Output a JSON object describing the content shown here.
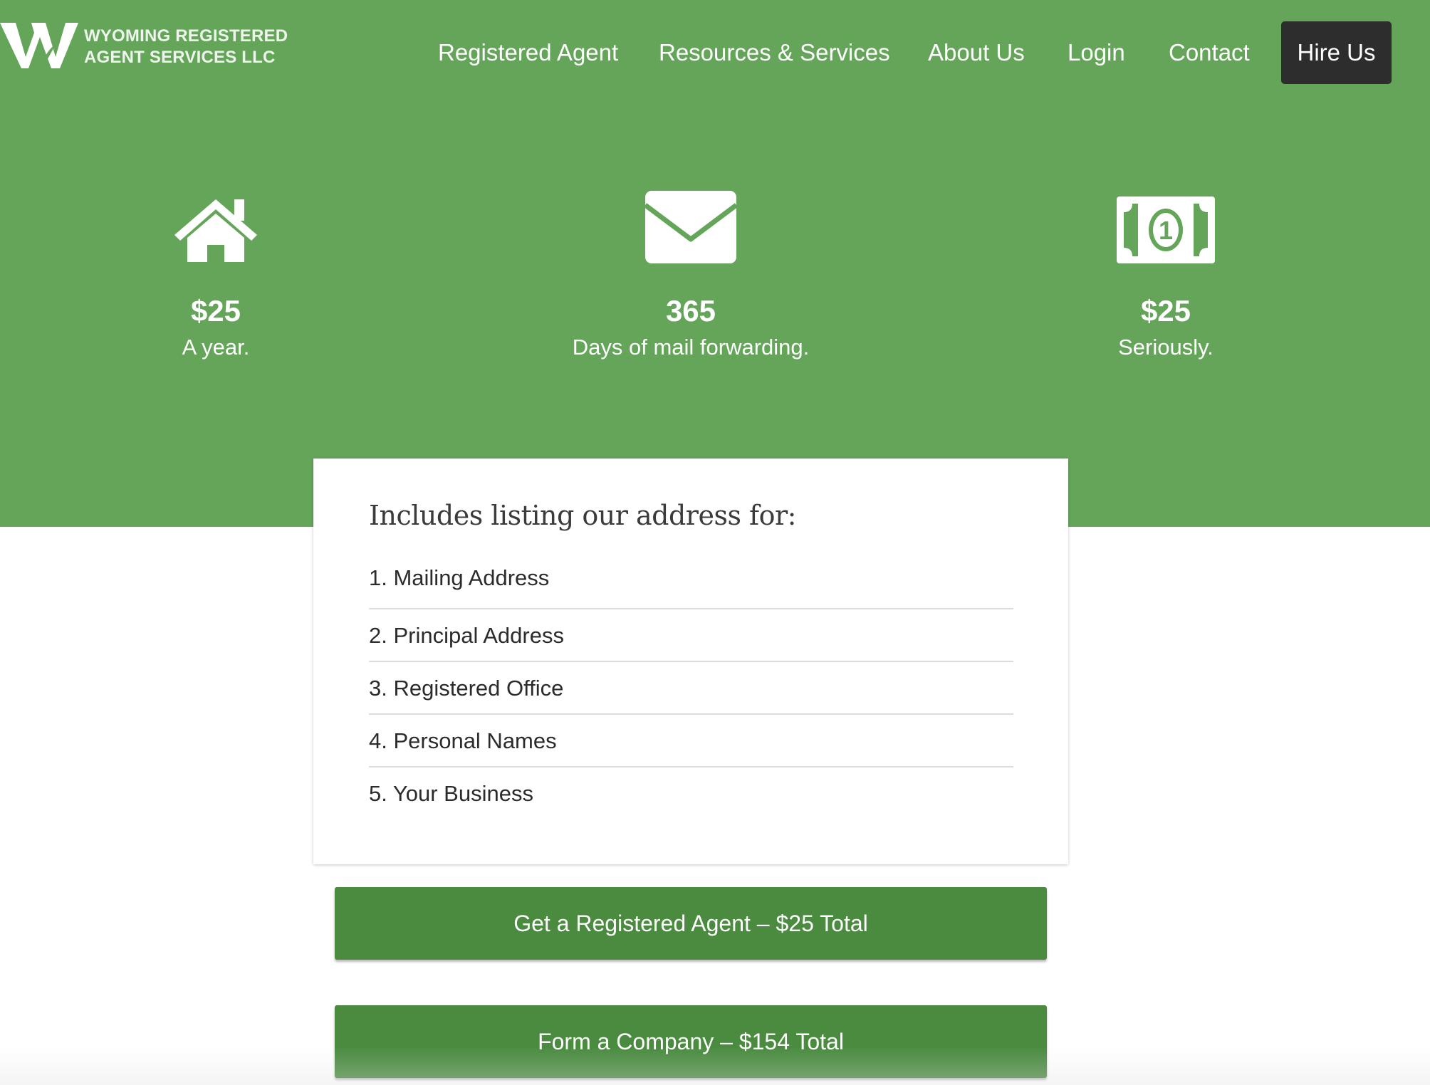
{
  "header": {
    "logo_line1": "WYOMING REGISTERED",
    "logo_line2": "AGENT SERVICES LLC",
    "nav": [
      {
        "label": "Registered Agent"
      },
      {
        "label": "Resources & Services"
      },
      {
        "label": "About Us"
      },
      {
        "label": "Login"
      },
      {
        "label": "Contact"
      }
    ],
    "hire_label": "Hire Us"
  },
  "features": [
    {
      "icon": "house-icon",
      "value": "$25",
      "caption": "A year."
    },
    {
      "icon": "envelope-icon",
      "value": "365",
      "caption": "Days of mail forwarding."
    },
    {
      "icon": "dollar-bill-icon",
      "value": "$25",
      "caption": "Seriously."
    }
  ],
  "card": {
    "title": "Includes listing our address for:",
    "items": [
      "1. Mailing Address",
      "2. Principal Address",
      "3. Registered Office",
      "4. Personal Names",
      "5. Your Business"
    ]
  },
  "cta": {
    "registered_agent": "Get a Registered Agent – $25 Total",
    "form_company": "Form a Company – $154 Total"
  },
  "colors": {
    "hero_green": "#64a55a",
    "button_green": "#4a8b40",
    "hire_dark": "#2d2d2d"
  }
}
